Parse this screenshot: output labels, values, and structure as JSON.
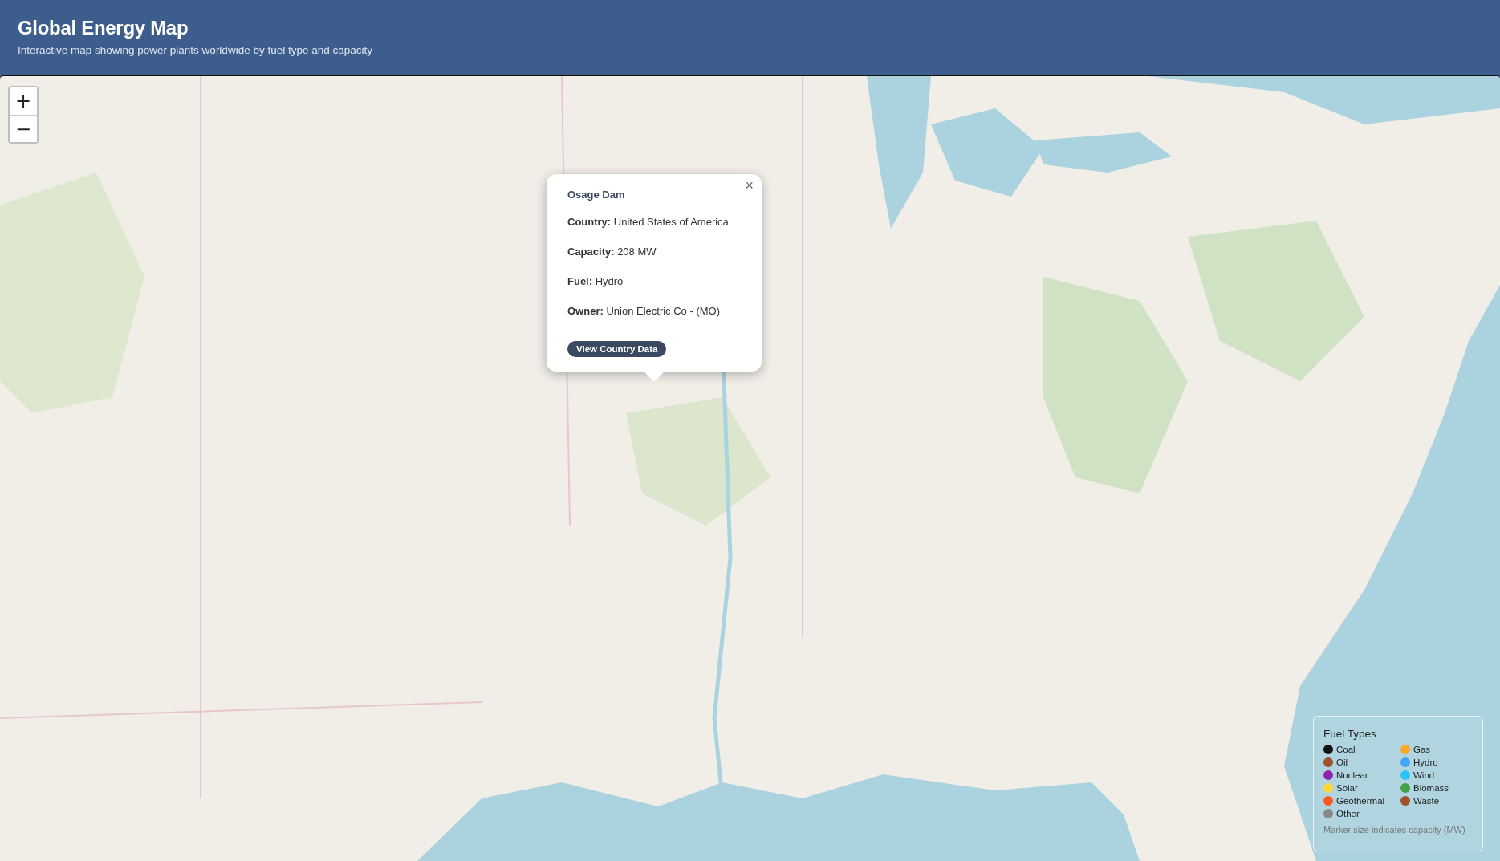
{
  "header": {
    "title": "Global Energy Map",
    "subtitle": "Interactive map showing power plants worldwide by fuel type and capacity"
  },
  "map": {
    "kind": "picture",
    "zoom_controls": [
      "+",
      "−"
    ]
  },
  "popup": {
    "title": "Osage Dam",
    "close": "×",
    "fields": [
      {
        "label": "Country:",
        "value": "United States of America"
      },
      {
        "label": "Capacity:",
        "value": "208 MW"
      },
      {
        "label": "Fuel:",
        "value": "Hydro"
      },
      {
        "label": "Owner:",
        "value": "Union Electric Co - (MO)"
      }
    ],
    "button": "View Country Data"
  },
  "legend": {
    "title": "Fuel Types",
    "items": [
      {
        "label": "Coal",
        "color": "#111111"
      },
      {
        "label": "Gas",
        "color": "#ffa726"
      },
      {
        "label": "Oil",
        "color": "#a0522d"
      },
      {
        "label": "Hydro",
        "color": "#42a5f5"
      },
      {
        "label": "Nuclear",
        "color": "#8e24aa"
      },
      {
        "label": "Wind",
        "color": "#29c5f6"
      },
      {
        "label": "Solar",
        "color": "#fdd835"
      },
      {
        "label": "Biomass",
        "color": "#43a047"
      },
      {
        "label": "Geothermal",
        "color": "#ff5722"
      },
      {
        "label": "Waste",
        "color": "#a0522d"
      },
      {
        "label": "Other",
        "color": "#888888"
      }
    ],
    "note": "Marker size indicates capacity (MW)"
  }
}
